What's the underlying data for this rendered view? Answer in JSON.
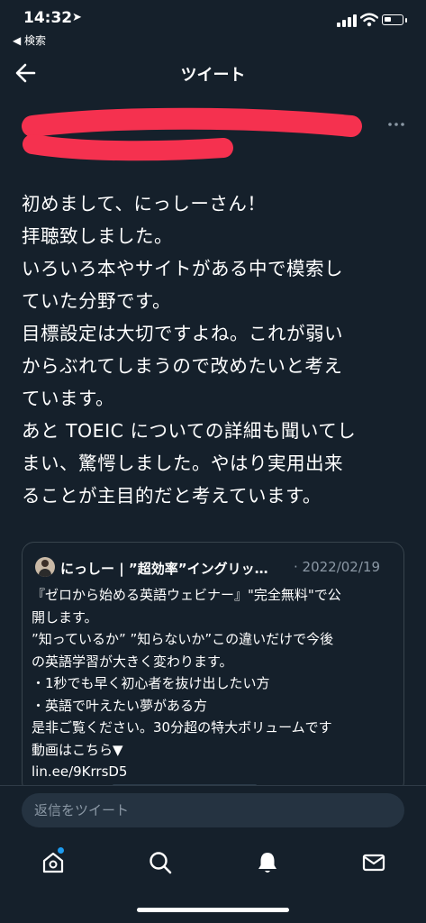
{
  "status_bar": {
    "time": "14:32",
    "back_app": "◀ 検索"
  },
  "header": {
    "title": "ツイート"
  },
  "tweet": {
    "lines": [
      "初めまして、にっしーさん！",
      "拝聴致しました。",
      "いろいろ本やサイトがある中で模索し",
      "ていた分野です。",
      "目標設定は大切ですよね。これが弱い",
      "からぶれてしまうので改めたいと考え",
      "ています。",
      "あと TOEIC についての詳細も聞いてし",
      "まい、驚愕しました。やはり実用出来",
      "ることが主目的だと考えています。"
    ]
  },
  "quote": {
    "author": "にっしー | ”超効率”イングリッ…",
    "date": "· 2022/02/19",
    "lines": [
      "『ゼロから始める英語ウェビナー』\"完全無料\"で公",
      "開します。",
      "”知っているか” ”知らないか”この違いだけで今後",
      "の英語学習が大きく変わります。",
      "・1秒でも早く初心者を抜け出したい方",
      "・英語で叶えたい夢がある方",
      "是非ご覧ください。30分超の特大ボリュームです",
      "動画はこちら▼",
      "lin.ee/9KrrsD5"
    ]
  },
  "reply": {
    "placeholder": "返信をツイート"
  },
  "tabbar": {
    "items": [
      "home-icon",
      "search-icon",
      "notifications-icon",
      "messages-icon"
    ]
  },
  "colors": {
    "background": "#15202b",
    "accent": "#1d9bf0",
    "redaction": "#f5314f"
  }
}
